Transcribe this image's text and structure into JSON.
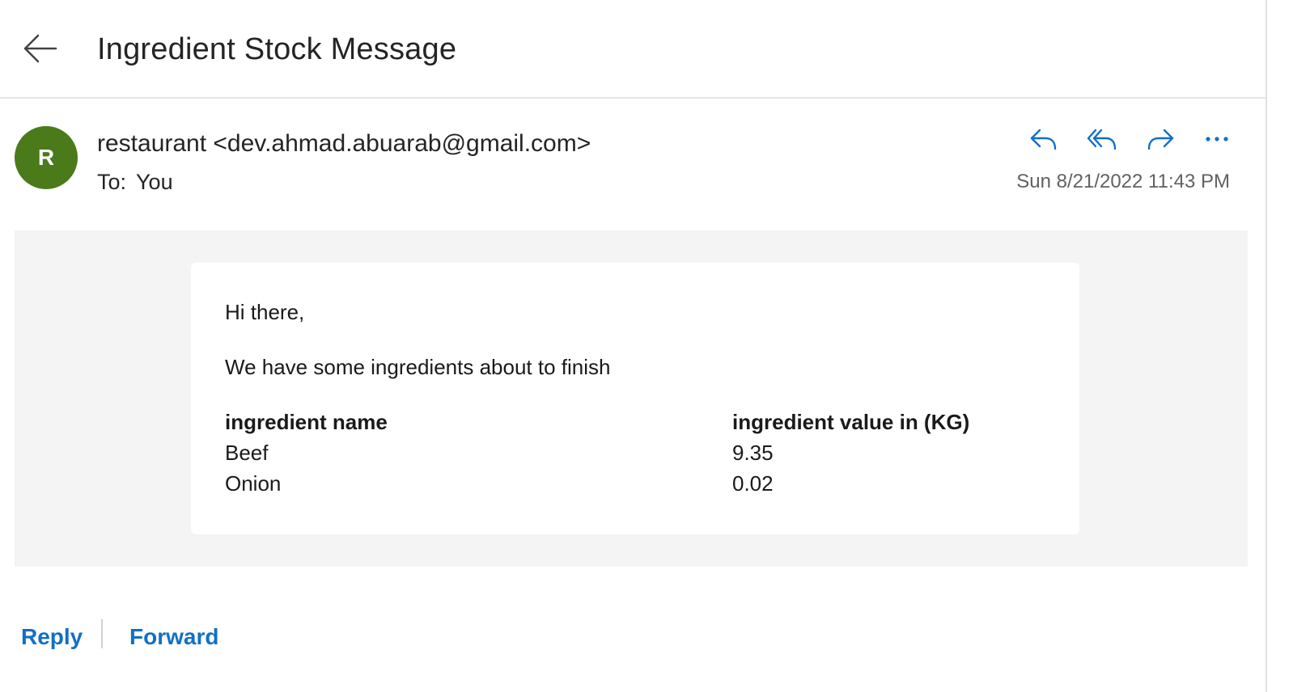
{
  "header": {
    "back_icon": "arrow-left-icon",
    "subject": "Ingredient Stock Message"
  },
  "message": {
    "avatar_initial": "R",
    "avatar_color": "#4a7a1a",
    "sender": "restaurant <dev.ahmad.abuarab@gmail.com>",
    "to_label": "To:",
    "to_value": "You",
    "timestamp": "Sun 8/21/2022 11:43 PM",
    "actions": [
      {
        "name": "reply",
        "icon": "reply-icon"
      },
      {
        "name": "reply-all",
        "icon": "reply-all-icon"
      },
      {
        "name": "forward",
        "icon": "forward-icon"
      },
      {
        "name": "more",
        "icon": "more-options-icon"
      }
    ]
  },
  "body": {
    "greeting": "Hi there,",
    "intro": "We have some ingredients about to finish",
    "table": {
      "headers": [
        "ingredient name",
        "ingredient value in (KG)"
      ],
      "rows": [
        [
          "Beef",
          "9.35"
        ],
        [
          "Onion",
          "0.02"
        ]
      ]
    }
  },
  "footer": {
    "reply_label": "Reply",
    "forward_label": "Forward"
  },
  "colors": {
    "accent": "#1170c6",
    "body_background": "#f4f4f4"
  }
}
